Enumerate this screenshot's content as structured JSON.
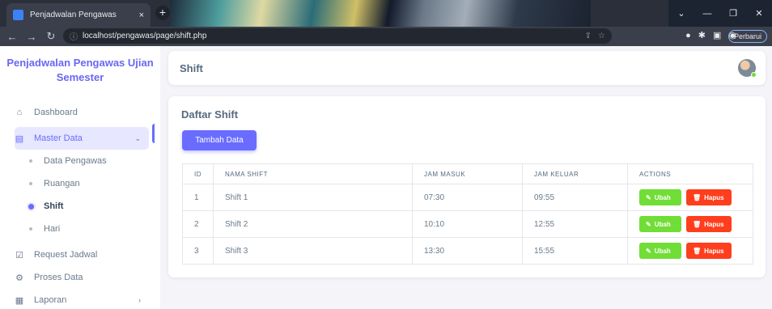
{
  "browser": {
    "tab_title": "Penjadwalan Pengawas",
    "tab_close": "×",
    "new_tab": "+",
    "url": "localhost/pengawas/page/shift.php",
    "update_label": "Perbarui"
  },
  "sidebar": {
    "brand": "Penjadwalan Pengawas Ujian Semester",
    "items": [
      {
        "label": "Dashboard",
        "icon": "home-icon"
      },
      {
        "label": "Master Data",
        "icon": "layout-icon"
      },
      {
        "label": "Request Jadwal",
        "icon": "check-square-icon"
      },
      {
        "label": "Proses Data",
        "icon": "gear-icon"
      },
      {
        "label": "Laporan",
        "icon": "file-icon"
      }
    ],
    "sub_items": [
      "Data Pengawas",
      "Ruangan",
      "Shift",
      "Hari"
    ]
  },
  "header": {
    "title": "Shift"
  },
  "main": {
    "card_title": "Daftar Shift",
    "add_button": "Tambah Data",
    "columns": [
      "ID",
      "NAMA SHIFT",
      "JAM MASUK",
      "JAM KELUAR",
      "ACTIONS"
    ],
    "rows": [
      {
        "id": "1",
        "name": "Shift 1",
        "in": "07:30",
        "out": "09:55"
      },
      {
        "id": "2",
        "name": "Shift 2",
        "in": "10:10",
        "out": "12:55"
      },
      {
        "id": "3",
        "name": "Shift 3",
        "in": "13:30",
        "out": "15:55"
      }
    ],
    "edit_label": "Ubah",
    "delete_label": "Hapus"
  },
  "colors": {
    "primary": "#696cff",
    "success": "#71dd37",
    "danger": "#ff3e1d"
  }
}
